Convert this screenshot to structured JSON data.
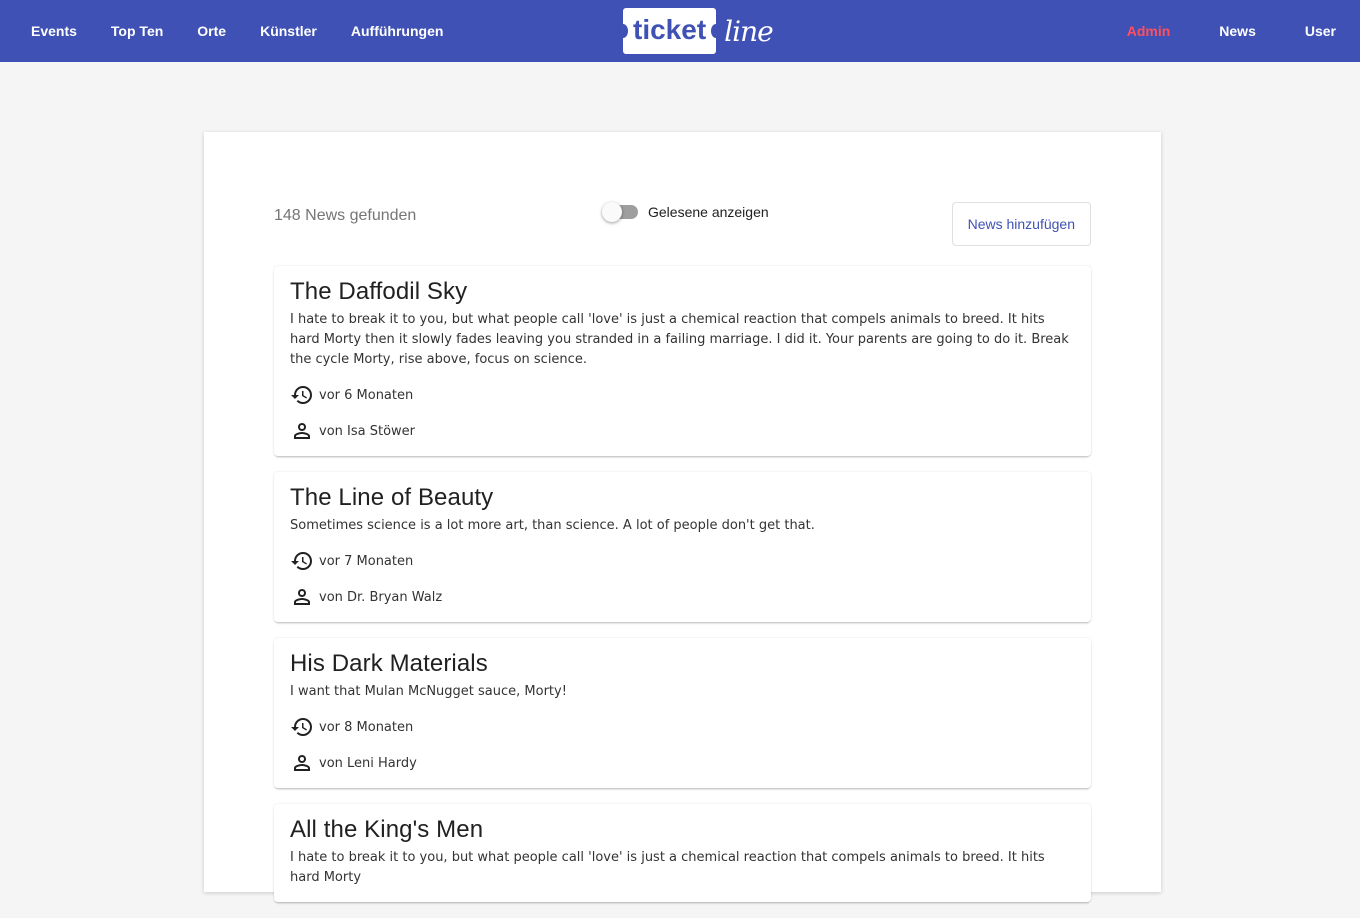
{
  "nav": {
    "left": [
      {
        "label": "Events"
      },
      {
        "label": "Top Ten"
      },
      {
        "label": "Orte"
      },
      {
        "label": "Künstler"
      },
      {
        "label": "Aufführungen"
      }
    ],
    "logo": {
      "ticket": "ticket",
      "line": "line"
    },
    "right": [
      {
        "label": "Admin"
      },
      {
        "label": "News"
      },
      {
        "label": "User"
      }
    ]
  },
  "toolbar": {
    "count_text": "148 News gefunden",
    "toggle_label": "Gelesene anzeigen",
    "toggle_on": false,
    "add_button": "News hinzufügen"
  },
  "news": [
    {
      "title": "The Daffodil Sky",
      "body": "I hate to break it to you, but what people call 'love' is just a chemical reaction that compels animals to breed. It hits hard Morty then it slowly fades leaving you stranded in a failing marriage. I did it. Your parents are going to do it. Break the cycle Morty, rise above, focus on science.",
      "time": "vor 6 Monaten",
      "author": "von Isa Stöwer"
    },
    {
      "title": "The Line of Beauty",
      "body": "Sometimes science is a lot more art, than science. A lot of people don't get that.",
      "time": "vor 7 Monaten",
      "author": "von Dr. Bryan Walz"
    },
    {
      "title": "His Dark Materials",
      "body": "I want that Mulan McNugget sauce, Morty!",
      "time": "vor 8 Monaten",
      "author": "von Leni Hardy"
    },
    {
      "title": "All the King's Men",
      "body": "I hate to break it to you, but what people call 'love' is just a chemical reaction that compels animals to breed. It hits hard Morty",
      "time": "",
      "author": ""
    }
  ],
  "colors": {
    "primary": "#3f51b5",
    "admin": "#ff4f5e",
    "background": "#f5f5f5"
  },
  "icons": {
    "time": "history-icon",
    "author": "person-icon"
  }
}
